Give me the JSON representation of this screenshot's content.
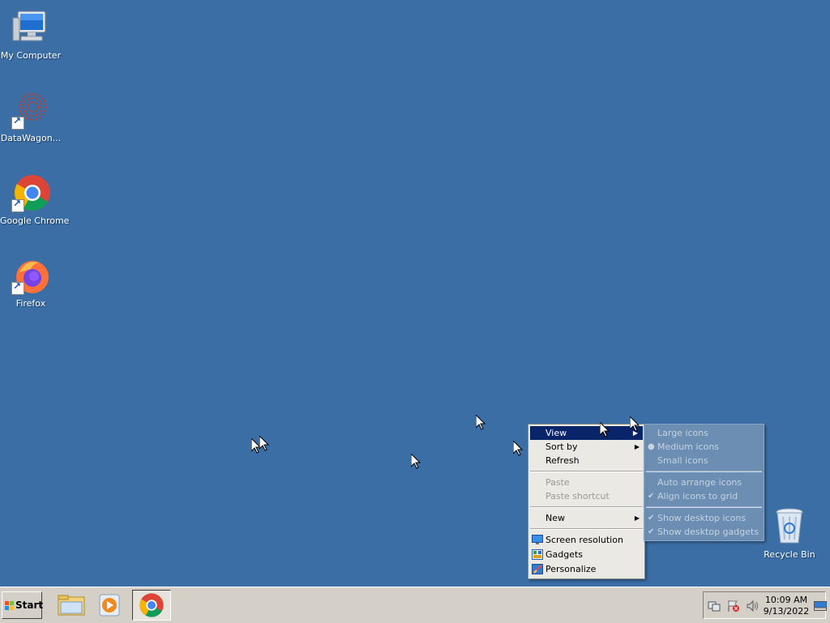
{
  "desktop": {
    "icons": [
      {
        "label": "My Computer"
      },
      {
        "label": "DataWagon..."
      },
      {
        "label": "Google Chrome"
      },
      {
        "label": "Firefox"
      },
      {
        "label": "Recycle Bin"
      }
    ]
  },
  "context_menu": {
    "items": [
      {
        "label": "View",
        "highlighted": true,
        "submenu": true
      },
      {
        "label": "Sort by",
        "submenu": true
      },
      {
        "label": "Refresh"
      },
      {
        "label": "Paste",
        "disabled": true
      },
      {
        "label": "Paste shortcut",
        "disabled": true
      },
      {
        "label": "New",
        "submenu": true
      },
      {
        "label": "Screen resolution"
      },
      {
        "label": "Gadgets"
      },
      {
        "label": "Personalize"
      }
    ]
  },
  "view_submenu": {
    "items": [
      {
        "label": "Large icons"
      },
      {
        "label": "Medium icons",
        "selected": true
      },
      {
        "label": "Small icons"
      },
      {
        "label": "Auto arrange icons"
      },
      {
        "label": "Align icons to grid",
        "checked": true
      },
      {
        "label": "Show desktop icons",
        "checked": true
      },
      {
        "label": "Show desktop gadgets",
        "checked": true
      }
    ]
  },
  "taskbar": {
    "start_label": "Start",
    "clock_time": "10:09 AM",
    "clock_date": "9/13/2022"
  },
  "colors": {
    "desktop": "#3a6ea5",
    "menu_bg": "#ebe9e3",
    "highlight": "#0a246a",
    "taskbar": "#d4d0c8"
  }
}
